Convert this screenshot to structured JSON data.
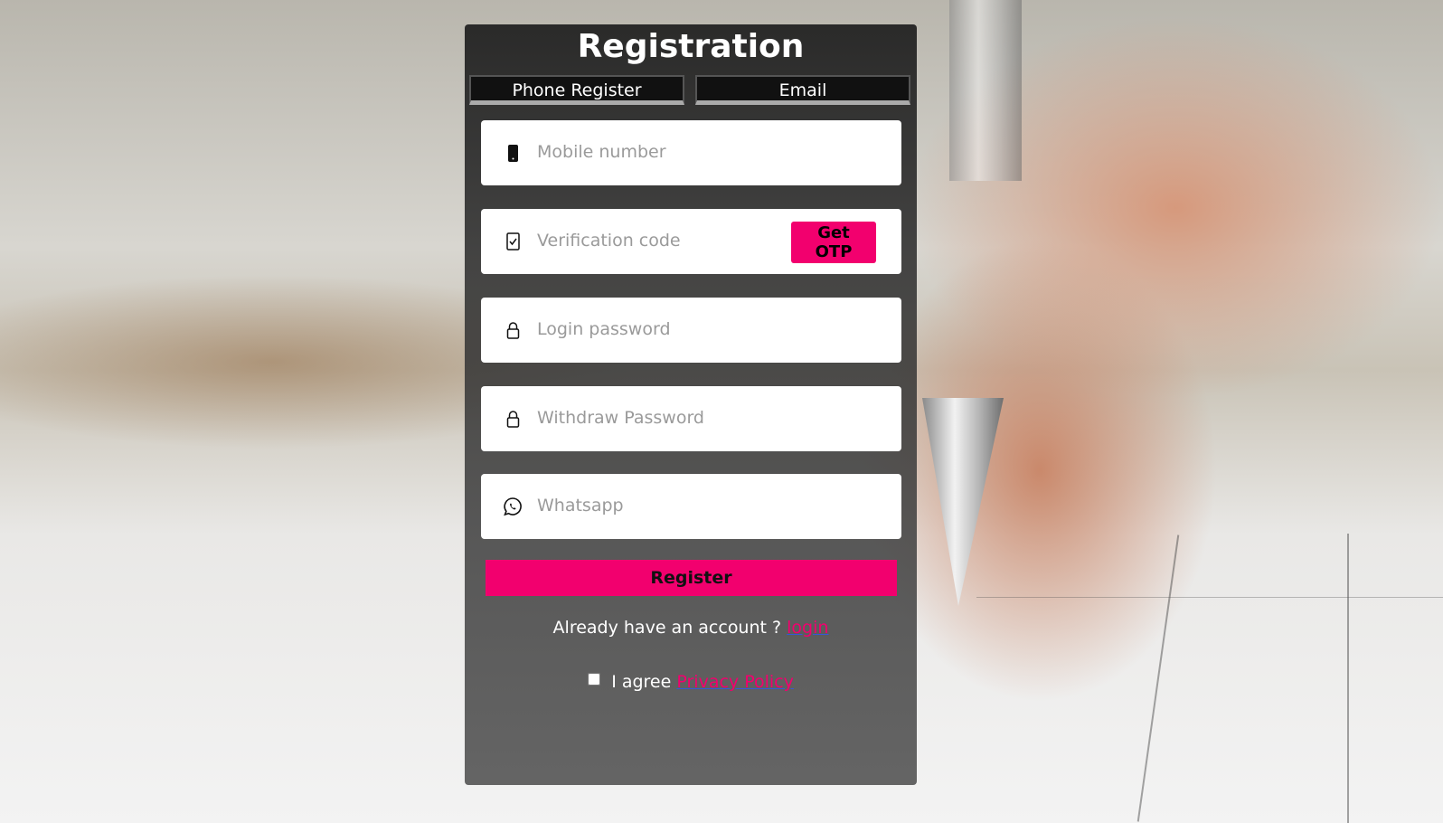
{
  "page": {
    "title": "Registration"
  },
  "tabs": [
    {
      "label": "Phone Register"
    },
    {
      "label": "Email"
    }
  ],
  "form": {
    "mobile": {
      "placeholder": "Mobile number",
      "icon": "phone-icon"
    },
    "verification": {
      "placeholder": "Verification code",
      "icon": "checklist-icon",
      "button": "Get OTP"
    },
    "login_password": {
      "placeholder": "Login password",
      "icon": "lock-icon"
    },
    "withdraw_password": {
      "placeholder": "Withdraw Password",
      "icon": "lock-icon"
    },
    "whatsapp": {
      "placeholder": "Whatsapp",
      "icon": "whatsapp-icon"
    },
    "register_label": "Register"
  },
  "footer": {
    "already_text": "Already have an account ?",
    "login_link": "login",
    "agree_text": "I agree",
    "privacy_link": "Privacy Policy"
  },
  "colors": {
    "accent": "#f2006e",
    "card": "#3a3a3a"
  }
}
